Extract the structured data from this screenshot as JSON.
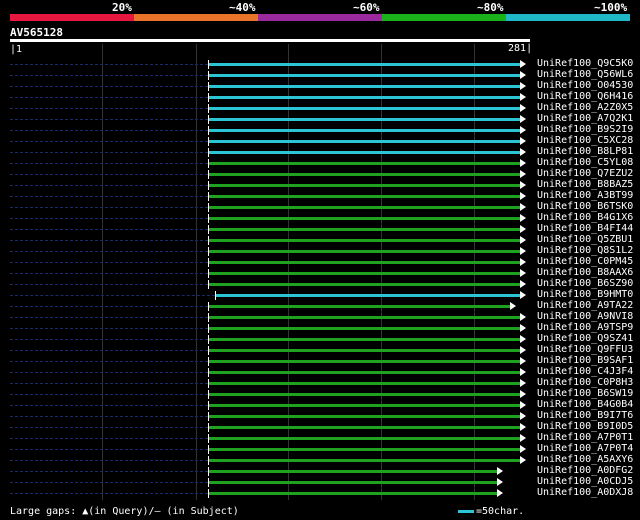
{
  "scale": {
    "labels": [
      "20%",
      "~40%",
      "~60%",
      "~80%",
      "~100%"
    ],
    "colors": [
      "#e8173f",
      "#e8752a",
      "#9b2a9e",
      "#1bb11b",
      "#1eb8c8"
    ]
  },
  "query": {
    "id": "AV565128",
    "start": "1",
    "end": "281"
  },
  "hit_colors": {
    "cyan": "#2cc5d6",
    "green": "#1fa21f",
    "dashed": "#1b2a6b"
  },
  "hits": [
    {
      "name": "UniRef100_Q9C5K0",
      "color": "cyan"
    },
    {
      "name": "UniRef100_Q56WL6",
      "color": "cyan"
    },
    {
      "name": "UniRef100_O04530",
      "color": "cyan"
    },
    {
      "name": "UniRef100_Q6H416",
      "color": "cyan"
    },
    {
      "name": "UniRef100_A2Z0X5",
      "color": "cyan"
    },
    {
      "name": "UniRef100_A7Q2K1",
      "color": "cyan"
    },
    {
      "name": "UniRef100_B9S2I9",
      "color": "cyan"
    },
    {
      "name": "UniRef100_C5XC28",
      "color": "cyan"
    },
    {
      "name": "UniRef100_B8LP81",
      "color": "cyan"
    },
    {
      "name": "UniRef100_C5YL08",
      "color": "green"
    },
    {
      "name": "UniRef100_Q7EZU2",
      "color": "green"
    },
    {
      "name": "UniRef100_B8BAZ5",
      "color": "green"
    },
    {
      "name": "UniRef100_A3BT99",
      "color": "green"
    },
    {
      "name": "UniRef100_B6TSK0",
      "color": "green"
    },
    {
      "name": "UniRef100_B4G1X6",
      "color": "green"
    },
    {
      "name": "UniRef100_B4FI44",
      "color": "green"
    },
    {
      "name": "UniRef100_Q5ZBU1",
      "color": "green"
    },
    {
      "name": "UniRef100_Q8S1L2",
      "color": "green"
    },
    {
      "name": "UniRef100_C0PM45",
      "color": "green"
    },
    {
      "name": "UniRef100_B8AAX6",
      "color": "green"
    },
    {
      "name": "UniRef100_B6SZ90",
      "color": "green"
    },
    {
      "name": "UniRef100_B9HMT0",
      "color": "cyan",
      "shifted": true
    },
    {
      "name": "UniRef100_A9TA22",
      "color": "green",
      "short": true
    },
    {
      "name": "UniRef100_A9NVI8",
      "color": "green"
    },
    {
      "name": "UniRef100_A9TSP9",
      "color": "green"
    },
    {
      "name": "UniRef100_Q9SZ41",
      "color": "green"
    },
    {
      "name": "UniRef100_Q9FFU3",
      "color": "green"
    },
    {
      "name": "UniRef100_B9SAF1",
      "color": "green"
    },
    {
      "name": "UniRef100_C4J3F4",
      "color": "green"
    },
    {
      "name": "UniRef100_C0P8H3",
      "color": "green"
    },
    {
      "name": "UniRef100_B6SW19",
      "color": "green"
    },
    {
      "name": "UniRef100_B4G0B4",
      "color": "green"
    },
    {
      "name": "UniRef100_B9I7T6",
      "color": "green"
    },
    {
      "name": "UniRef100_B9I0D5",
      "color": "green"
    },
    {
      "name": "UniRef100_A7P0T1",
      "color": "green"
    },
    {
      "name": "UniRef100_A7P0T4",
      "color": "green"
    },
    {
      "name": "UniRef100_A5AXY6",
      "color": "green"
    },
    {
      "name": "UniRef100_A0DFG2",
      "color": "green",
      "shorter": true
    },
    {
      "name": "UniRef100_A0CDJ5",
      "color": "green",
      "shorter": true
    },
    {
      "name": "UniRef100_A0DXJ8",
      "color": "green",
      "shorter": true
    }
  ],
  "footer": {
    "gaps_text": "Large gaps: ▲(in Query)/– (in Subject)",
    "legend_text": "=50char."
  }
}
